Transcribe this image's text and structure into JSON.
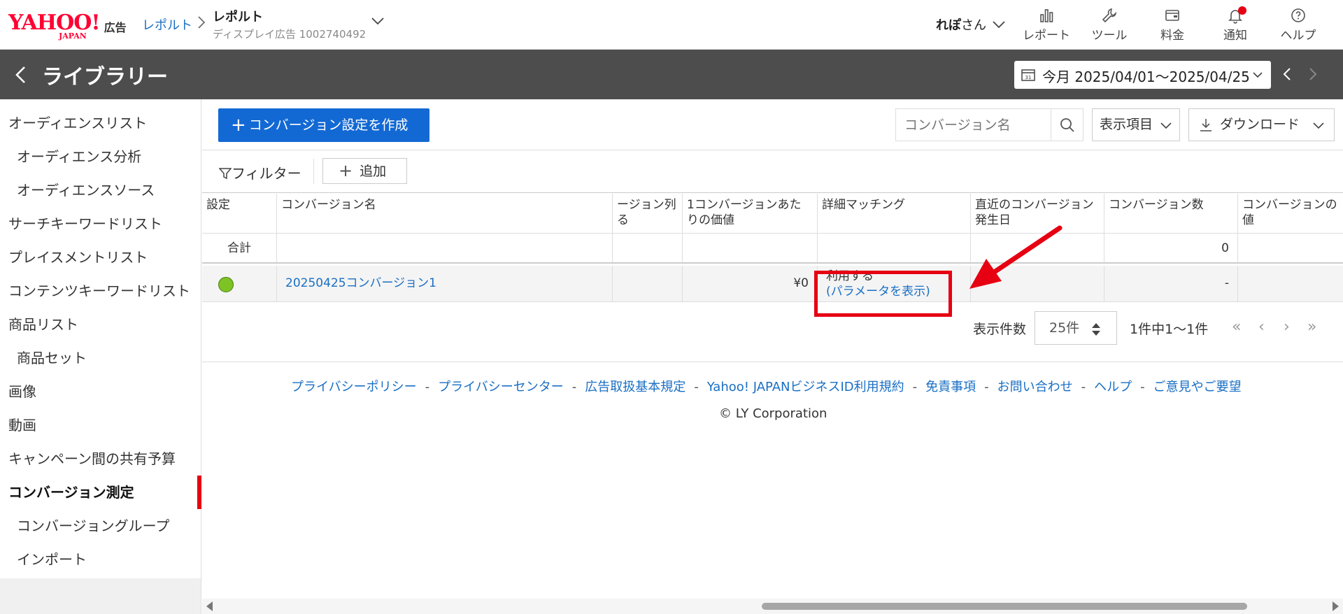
{
  "brand": {
    "logo": "YAHOO!",
    "logo_sub": "JAPAN",
    "logo_ad": "広告"
  },
  "breadcrumb": {
    "link": "レポルト",
    "title": "レポルト",
    "subtitle": "ディスプレイ広告 1002740492"
  },
  "user": {
    "name": "れぽ",
    "suffix": "さん"
  },
  "nav": {
    "report": "レポート",
    "tools": "ツール",
    "billing": "料金",
    "notify": "通知",
    "help": "ヘルプ"
  },
  "header": {
    "title": "ライブラリー",
    "date_range": "今月 2025/04/01～2025/04/25"
  },
  "sidebar": {
    "items": [
      {
        "label": "オーディエンスリスト"
      },
      {
        "label": "オーディエンス分析"
      },
      {
        "label": "オーディエンスソース"
      },
      {
        "label": "サーチキーワードリスト"
      },
      {
        "label": "プレイスメントリスト"
      },
      {
        "label": "コンテンツキーワードリスト"
      },
      {
        "label": "商品リスト"
      },
      {
        "label": "商品セット"
      },
      {
        "label": "画像"
      },
      {
        "label": "動画"
      },
      {
        "label": "キャンペーン間の共有予算"
      },
      {
        "label": "コンバージョン測定"
      },
      {
        "label": "コンバージョングループ"
      },
      {
        "label": "インポート"
      }
    ]
  },
  "toolbar": {
    "create_label": "コンバージョン設定を作成",
    "search_placeholder": "コンバージョン名",
    "columns_label": "表示項目",
    "download_label": "ダウンロード",
    "filter_label": "フィルター",
    "add_label": "追加"
  },
  "table": {
    "headers": {
      "setting": "設定",
      "name": "コンバージョン名",
      "col3": "ージョン列\nる",
      "value_per": "1コンバージョンあたりの価値",
      "matching": "詳細マッチング",
      "recent": "直近のコンバージョン発生日",
      "count": "コンバージョン数",
      "value": "コンバージョンの値"
    },
    "total": {
      "label": "合計",
      "count": "0"
    },
    "rows": [
      {
        "name": "20250425コンバージョン1",
        "value_per": "¥0",
        "matching": "利用する",
        "matching_link": "(パラメータを表示)",
        "count": "-"
      }
    ]
  },
  "pager": {
    "label": "表示件数",
    "per_page": "25件",
    "range": "1件中1～1件"
  },
  "footer": {
    "links": [
      "プライバシーポリシー",
      "プライバシーセンター",
      "広告取扱基本規定",
      "Yahoo! JAPANビジネスID利用規約",
      "免責事項",
      "お問い合わせ",
      "ヘルプ",
      "ご意見やご要望"
    ],
    "separator": "-",
    "copyright": "© LY Corporation"
  },
  "colors": {
    "accent": "#1369d4",
    "header_bg": "#4d4d4d",
    "highlight": "#e60012",
    "status_active": "#7dc324"
  }
}
